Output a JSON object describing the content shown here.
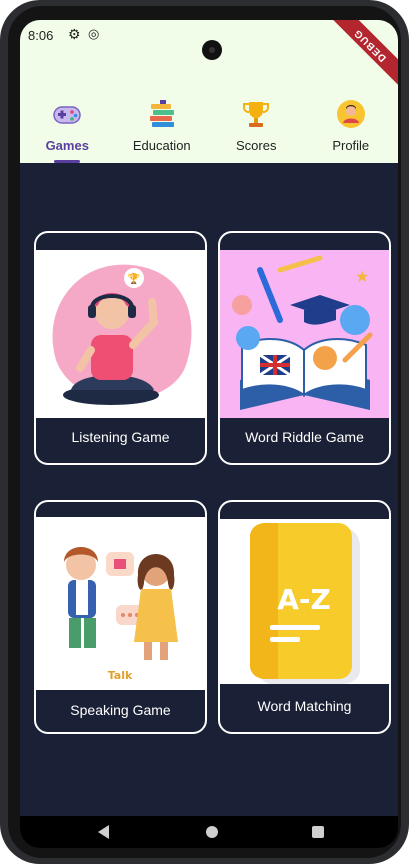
{
  "status": {
    "time": "8:06"
  },
  "debug_banner": "DEBUG",
  "nav": {
    "items": [
      {
        "label": "Games",
        "icon": "gamepad-icon"
      },
      {
        "label": "Education",
        "icon": "books-icon"
      },
      {
        "label": "Scores",
        "icon": "trophy-icon"
      },
      {
        "label": "Profile",
        "icon": "profile-icon"
      }
    ],
    "active": "Games"
  },
  "games": [
    {
      "title": "Listening Game",
      "art": "listening-illustration"
    },
    {
      "title": "Word Riddle Game",
      "art": "word-riddle-illustration"
    },
    {
      "title": "Speaking Game",
      "art": "speaking-illustration",
      "art_caption": "Talk"
    },
    {
      "title": "Word Matching",
      "art": "a-z-book-illustration",
      "art_text": "A-Z"
    }
  ],
  "colors": {
    "topbar": "#f1fde8",
    "background": "#1a2035",
    "accent": "#5b3fa0"
  }
}
